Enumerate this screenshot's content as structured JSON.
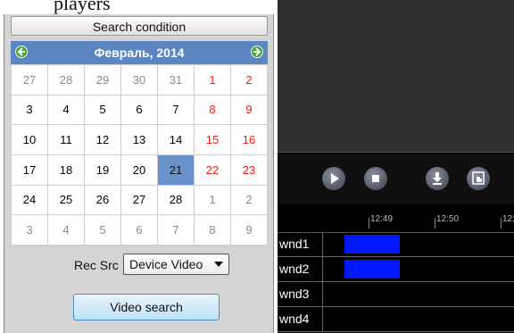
{
  "top_text": "players",
  "search": {
    "condition_label": "Search condition",
    "rec_src_label": "Rec Src",
    "rec_src_value": "Device Video",
    "video_search_label": "Video search"
  },
  "calendar": {
    "month_title": "Февраль,  2014",
    "prev_icon": "green-left-arrow-icon",
    "next_icon": "green-right-arrow-icon",
    "weeks": [
      [
        {
          "d": "27",
          "m": "other"
        },
        {
          "d": "28",
          "m": "other"
        },
        {
          "d": "29",
          "m": "other"
        },
        {
          "d": "30",
          "m": "other"
        },
        {
          "d": "31",
          "m": "other"
        },
        {
          "d": "1",
          "m": "cur"
        },
        {
          "d": "2",
          "m": "cur"
        }
      ],
      [
        {
          "d": "3",
          "m": "cur"
        },
        {
          "d": "4",
          "m": "cur"
        },
        {
          "d": "5",
          "m": "cur"
        },
        {
          "d": "6",
          "m": "cur"
        },
        {
          "d": "7",
          "m": "cur"
        },
        {
          "d": "8",
          "m": "cur"
        },
        {
          "d": "9",
          "m": "cur"
        }
      ],
      [
        {
          "d": "10",
          "m": "cur"
        },
        {
          "d": "11",
          "m": "cur"
        },
        {
          "d": "12",
          "m": "cur"
        },
        {
          "d": "13",
          "m": "cur"
        },
        {
          "d": "14",
          "m": "cur"
        },
        {
          "d": "15",
          "m": "cur"
        },
        {
          "d": "16",
          "m": "cur"
        }
      ],
      [
        {
          "d": "17",
          "m": "cur"
        },
        {
          "d": "18",
          "m": "cur"
        },
        {
          "d": "19",
          "m": "cur"
        },
        {
          "d": "20",
          "m": "cur"
        },
        {
          "d": "21",
          "m": "cur"
        },
        {
          "d": "22",
          "m": "cur"
        },
        {
          "d": "23",
          "m": "cur"
        }
      ],
      [
        {
          "d": "24",
          "m": "cur"
        },
        {
          "d": "25",
          "m": "cur"
        },
        {
          "d": "26",
          "m": "cur"
        },
        {
          "d": "27",
          "m": "cur"
        },
        {
          "d": "28",
          "m": "cur"
        },
        {
          "d": "1",
          "m": "other"
        },
        {
          "d": "2",
          "m": "other"
        }
      ],
      [
        {
          "d": "3",
          "m": "other"
        },
        {
          "d": "4",
          "m": "other"
        },
        {
          "d": "5",
          "m": "other"
        },
        {
          "d": "6",
          "m": "other"
        },
        {
          "d": "7",
          "m": "other"
        },
        {
          "d": "8",
          "m": "other"
        },
        {
          "d": "9",
          "m": "other"
        }
      ]
    ],
    "selected_day": "21",
    "weekend_color": "#ee1b1b",
    "selected_color": "#6892c9",
    "header_color": "#5b86c2"
  },
  "player": {
    "controls": [
      {
        "name": "play-icon"
      },
      {
        "name": "stop-icon"
      },
      {
        "name": "download-icon"
      },
      {
        "name": "hand-icon"
      }
    ],
    "timeline_ticks": [
      "12:49",
      "12:50",
      "12:"
    ],
    "tracks": [
      {
        "label": "wnd1",
        "has_recording": true
      },
      {
        "label": "wnd2",
        "has_recording": true
      },
      {
        "label": "wnd3",
        "has_recording": false
      },
      {
        "label": "wnd4",
        "has_recording": false
      }
    ],
    "recording_color": "#0019ff"
  }
}
